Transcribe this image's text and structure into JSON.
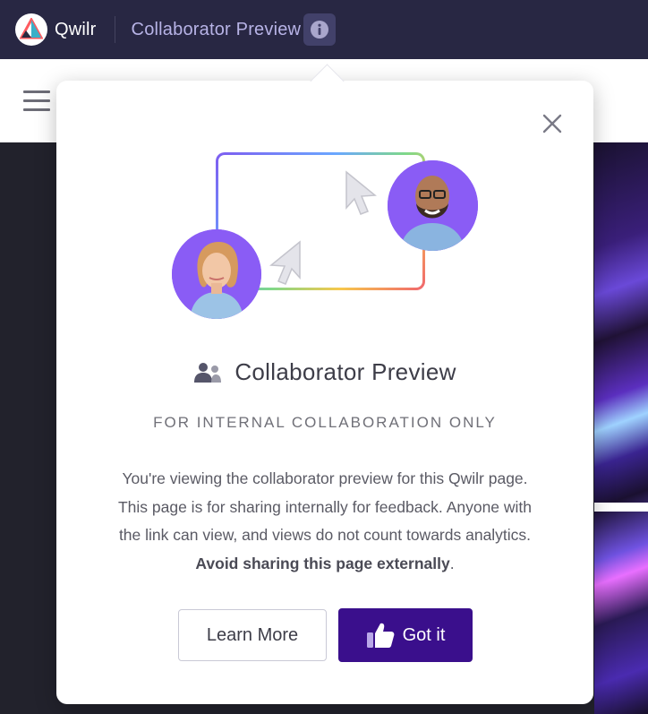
{
  "topbar": {
    "brand": "Qwilr",
    "title": "Collaborator Preview",
    "info_icon": "info-icon",
    "logo_icon": "qwilr-logo-icon"
  },
  "subbar": {
    "menu_icon": "hamburger-menu-icon"
  },
  "modal": {
    "close_icon": "close-icon",
    "title_icon": "people-icon",
    "title": "Collaborator Preview",
    "subtitle": "FOR INTERNAL COLLABORATION ONLY",
    "body_line1": "You're viewing the collaborator preview for this Qwilr page.",
    "body_line2": "This page is for sharing internally for feedback. Anyone with",
    "body_line3": "the link can view, and views do not count towards analytics.",
    "body_bold": "Avoid sharing this page externally",
    "body_end": ".",
    "learn_more": "Learn More",
    "got_it": "Got it",
    "got_it_icon": "thumbs-up-icon"
  },
  "colors": {
    "topbar_bg": "#282743",
    "accent_purple": "#3a0f8c",
    "avatar_bg": "#8a5cf5",
    "title_text": "#3d3d48"
  }
}
